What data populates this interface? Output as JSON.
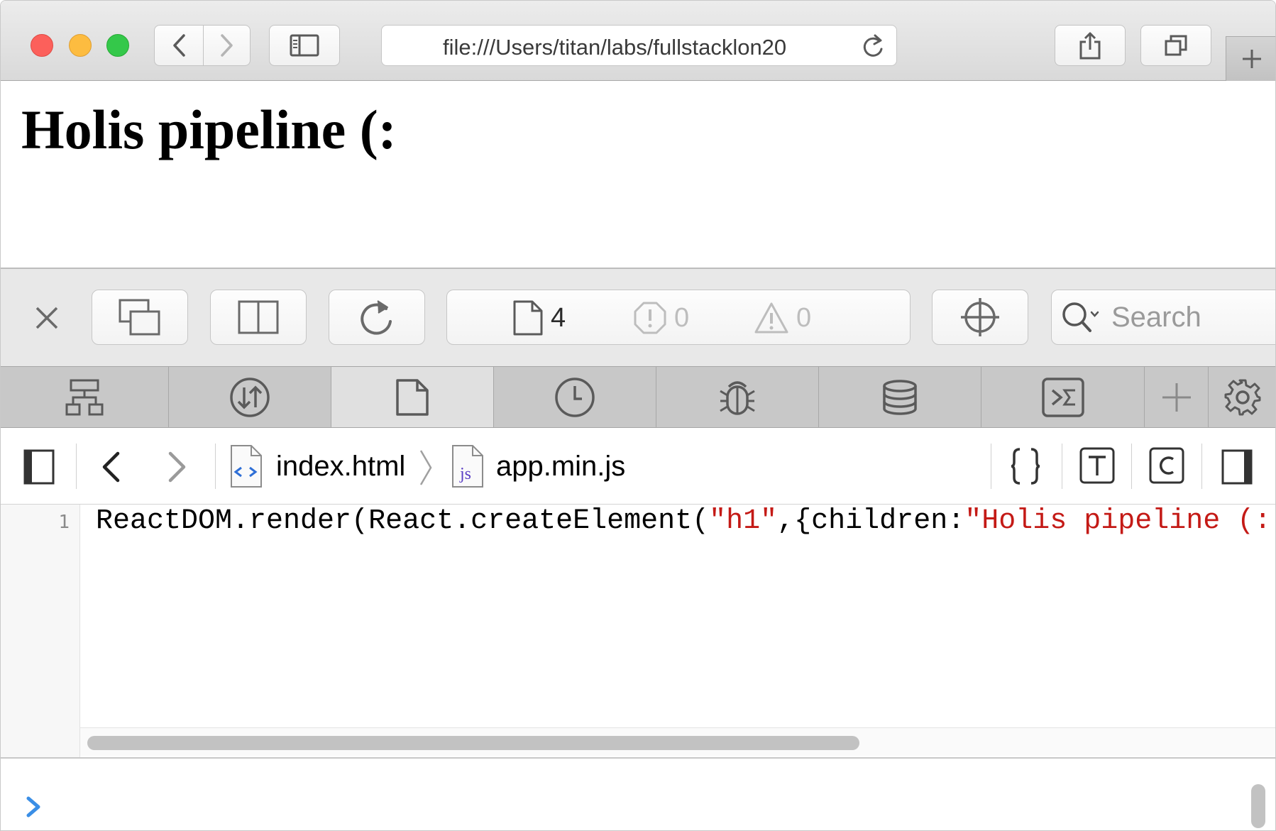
{
  "browser": {
    "url": "file:///Users/titan/labs/fullstacklon20",
    "icons": {
      "back": "chevron-left-icon",
      "forward": "chevron-right-icon",
      "sidebar": "sidebar-icon",
      "reload": "reload-icon",
      "share": "share-icon",
      "tabs": "tab-overview-icon",
      "new_tab": "plus-icon"
    }
  },
  "page": {
    "heading": "Holis pipeline (:"
  },
  "inspector": {
    "resources_count": "4",
    "errors_count": "0",
    "warnings_count": "0",
    "search_placeholder": "Search",
    "tabs": [
      {
        "name": "elements",
        "icon": "dom-tree-icon",
        "active": false
      },
      {
        "name": "network",
        "icon": "network-icon",
        "active": false
      },
      {
        "name": "resources",
        "icon": "document-icon",
        "active": true
      },
      {
        "name": "timelines",
        "icon": "clock-icon",
        "active": false
      },
      {
        "name": "debugger",
        "icon": "bug-icon",
        "active": false
      },
      {
        "name": "storage",
        "icon": "database-icon",
        "active": false
      },
      {
        "name": "console",
        "icon": "console-icon",
        "active": false
      }
    ],
    "breadcrumb": [
      {
        "label": "index.html",
        "icon": "html-file-icon"
      },
      {
        "label": "app.min.js",
        "icon": "js-file-icon"
      }
    ],
    "code": {
      "line_number": "1",
      "segments": [
        "ReactDOM.render(React.createElement(",
        "\"h1\"",
        ",{children:",
        "\"Holis pipeline (:"
      ]
    }
  },
  "colors": {
    "string_literal": "#c41a16",
    "prompt_blue": "#3a8ee6",
    "traffic_red": "#fc605b",
    "traffic_yellow": "#fdbc40",
    "traffic_green": "#34c84a"
  }
}
